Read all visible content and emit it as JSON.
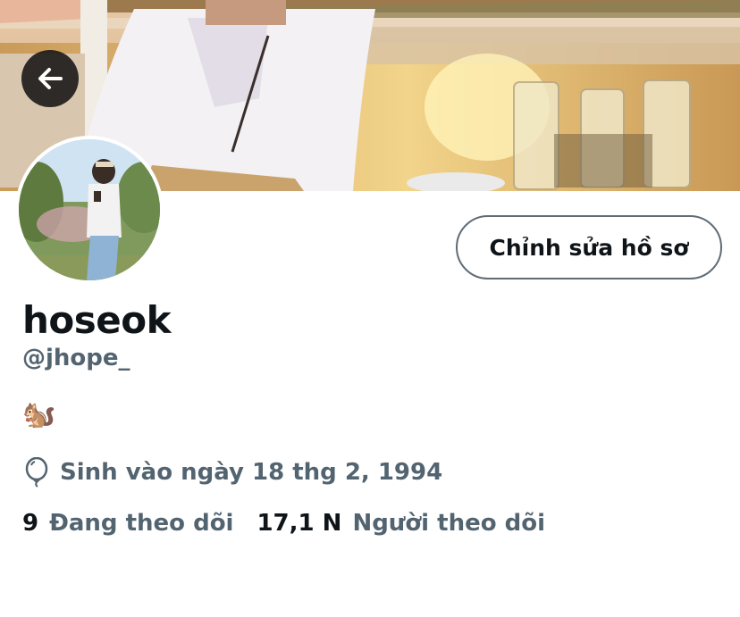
{
  "profile": {
    "display_name": "hoseok",
    "handle": "@jhope_",
    "bio_emoji": "🐿️",
    "birth_text": "Sinh vào ngày 18 thg 2, 1994",
    "following_count": "9",
    "following_label": "Đang theo dõi",
    "followers_count": "17,1 N",
    "followers_label": "Người theo dõi"
  },
  "actions": {
    "edit_profile_label": "Chỉnh sửa hồ sơ"
  },
  "icons": {
    "back": "arrow-left-icon",
    "birth": "balloon-icon"
  },
  "colors": {
    "text_primary": "#0f1419",
    "text_secondary": "#536471",
    "button_border": "#5f6b75"
  }
}
